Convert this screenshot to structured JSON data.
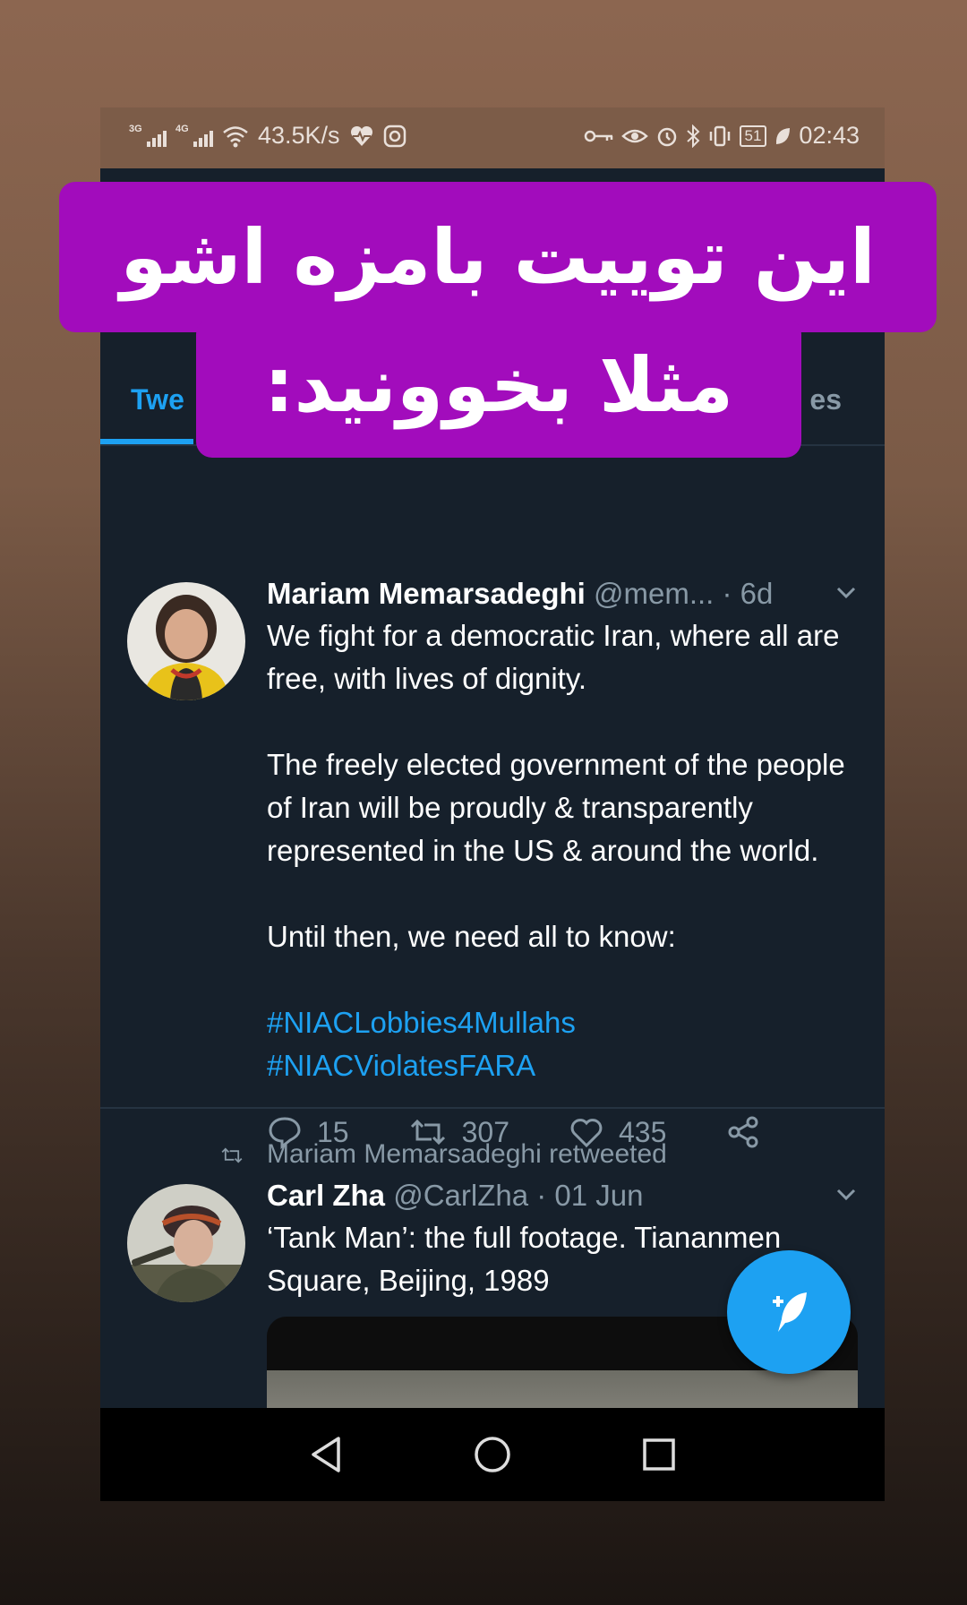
{
  "overlay": {
    "line1": "این توییت بامزه اشو",
    "line2": "مثلا بخوونید:",
    "color": "#a20cbc"
  },
  "status_bar": {
    "net1": "3G",
    "net2": "4G",
    "speed": "43.5K/s",
    "battery": "51",
    "time": "02:43",
    "icons": [
      "signal-icon",
      "wifi-icon",
      "heart-pulse-icon",
      "instagram-icon",
      "key-icon",
      "eye-icon",
      "alarm-icon",
      "bluetooth-icon",
      "vibrate-icon",
      "battery-icon",
      "leaf-icon"
    ]
  },
  "header": {
    "tab_left": "Twe",
    "tab_right": "es",
    "accent": "#1da1f2"
  },
  "tweets": [
    {
      "name": "Mariam Memarsadeghi",
      "handle": "@mem...",
      "time": "· 6d",
      "paragraphs": [
        "We fight for a democratic Iran, where all are free, with lives of dignity.",
        "The freely elected government of the people of Iran will be proudly & transparently represented in the US & around the world.",
        "Until then, we need all to know:"
      ],
      "hashtags": [
        "#NIACLobbies4Mullahs",
        "#NIACViolatesFARA"
      ],
      "replies": "15",
      "retweets": "307",
      "likes": "435"
    },
    {
      "retweeted_by": "Mariam Memarsadeghi retweeted",
      "name": "Carl Zha",
      "handle": "@CarlZha",
      "time": "· 01 Jun",
      "text": "‘Tank Man’: the full footage.  Tiananmen Square, Beijing, 1989"
    }
  ]
}
